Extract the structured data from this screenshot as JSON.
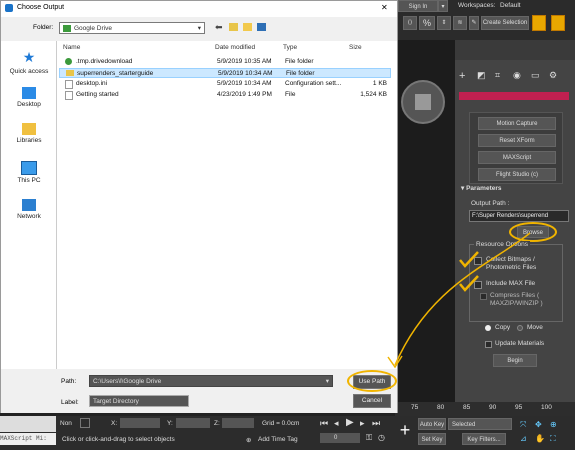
{
  "dialog": {
    "title": "Choose Output",
    "close_label": "✕",
    "folder_label": "Folder:",
    "folder_value": "Google Drive",
    "nav": [
      {
        "label": "Quick access",
        "icon": "star-icon"
      },
      {
        "label": "Desktop",
        "icon": "desktop-icon"
      },
      {
        "label": "Libraries",
        "icon": "libraries-icon"
      },
      {
        "label": "This PC",
        "icon": "pc-icon"
      },
      {
        "label": "Network",
        "icon": "network-icon"
      }
    ],
    "columns": {
      "name": "Name",
      "date": "Date modified",
      "type": "Type",
      "size": "Size"
    },
    "files": [
      {
        "name": ".tmp.drivedownload",
        "date": "5/9/2019 10:35 AM",
        "type": "File folder",
        "size": "",
        "icon": "sync-folder-icon"
      },
      {
        "name": "superrenders_starterguide",
        "date": "5/9/2019 10:34 AM",
        "type": "File folder",
        "size": "",
        "icon": "folder-icon"
      },
      {
        "name": "desktop.ini",
        "date": "5/9/2019 10:34 AM",
        "type": "Configuration sett...",
        "size": "1 KB",
        "icon": "file-icon"
      },
      {
        "name": "Getting started",
        "date": "4/23/2019 1:49 PM",
        "type": "File",
        "size": "1,524 KB",
        "icon": "file-icon"
      }
    ],
    "path_label": "Path:",
    "path_value": "C:\\Users\\l\\Google Drive",
    "label_label": "Label:",
    "label_value": "Target Directory",
    "use_path": "Use Path",
    "cancel": "Cancel"
  },
  "max": {
    "sign_in": "Sign In",
    "workspaces_label": "Workspaces:",
    "workspaces_value": "Default",
    "create_selection": "Create Selection",
    "utilities": [
      "Motion Capture",
      "Reset XForm",
      "MAXScript",
      "Flight Studio (c)"
    ],
    "params_title": "Parameters",
    "output_path_label": "Output Path :",
    "output_path_value": "F:\\Super Renders\\superrend",
    "browse": "Browse",
    "resource_options": "Resource Options",
    "collect_bitmaps": "Collect Bitmaps / Photometric Files",
    "include_max": "Include MAX File",
    "compress_files": "Compress Files ( MAXZIP/WINZIP )",
    "copy": "Copy",
    "move": "Move",
    "update_materials": "Update Materials",
    "begin": "Begin",
    "ticks": [
      "75",
      "80",
      "85",
      "90",
      "95",
      "100"
    ],
    "status": {
      "maxscript": "MAXScript Mi:",
      "none": "Non",
      "x_label": "X:",
      "y_label": "Y:",
      "z_label": "Z:",
      "grid": "Grid = 0.0cm",
      "prompt": "Click or click-and-drag to select objects",
      "add_time_tag": "Add Time Tag",
      "frame": "0",
      "auto_key": "Auto Key",
      "set_key": "Set Key",
      "selected": "Selected",
      "key_filters": "Key Filters..."
    }
  }
}
